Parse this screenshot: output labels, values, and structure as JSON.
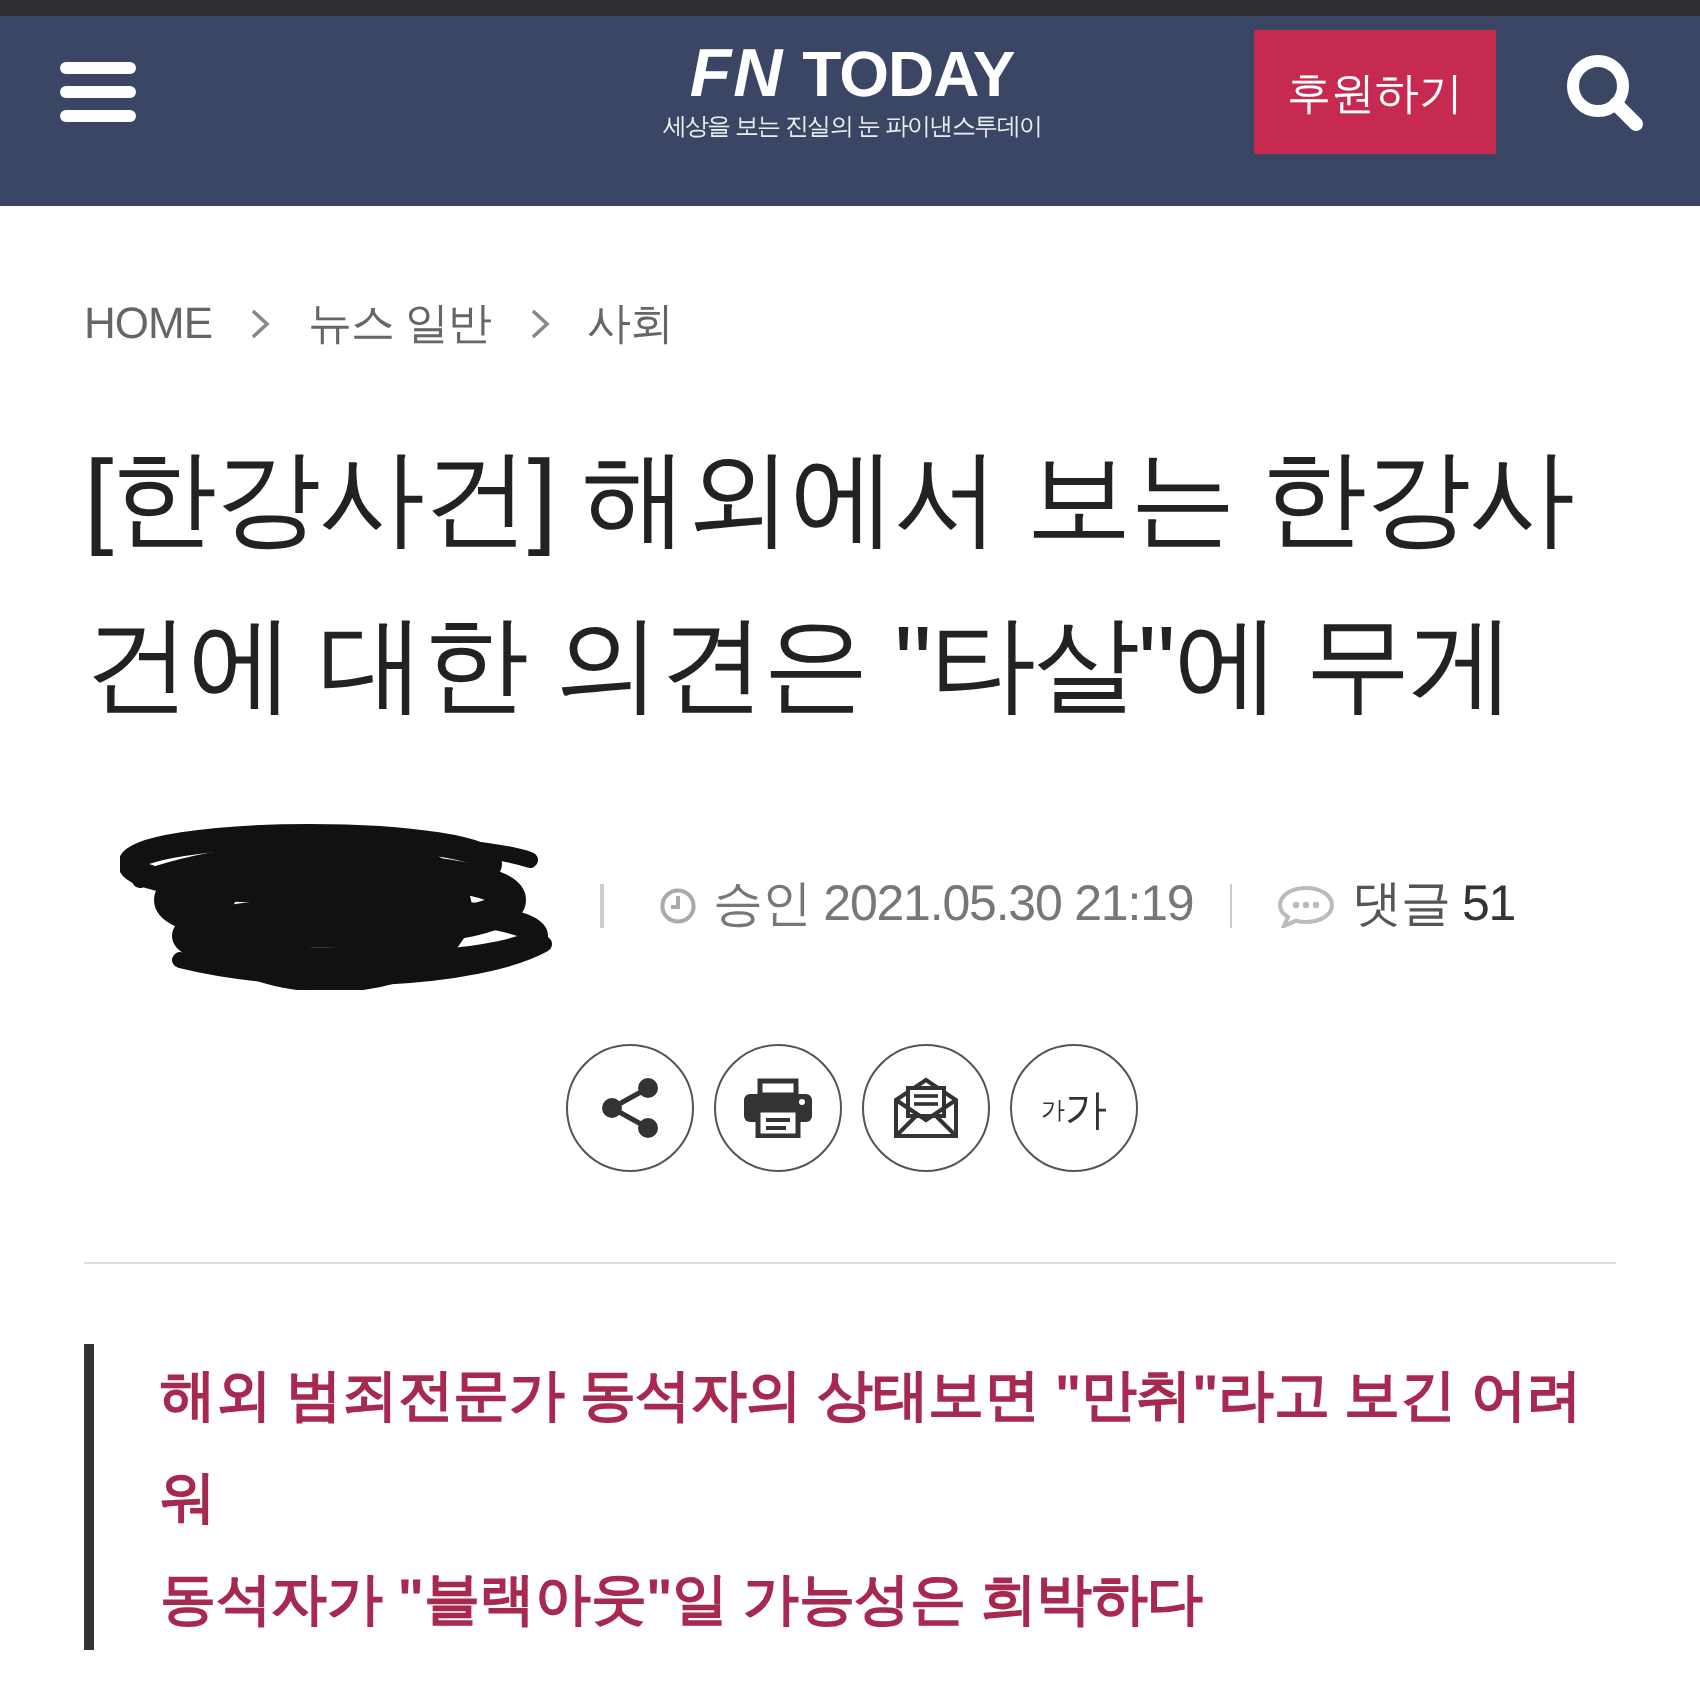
{
  "header": {
    "logo": {
      "mark": "FN",
      "wordmark": "TODAY",
      "tagline": "세상을 보는 진실의 눈 파이낸스투데이"
    },
    "donate_button": "후원하기"
  },
  "breadcrumb": [
    "HOME",
    "뉴스 일반",
    "사회"
  ],
  "title": "[한강사건] 해외에서 보는 한강사건에 대한 의견은 \"타살\"에 무게",
  "meta": {
    "approved": {
      "label": "승인",
      "datetime": "2021.05.30 21:19"
    },
    "comments": {
      "label": "댓글",
      "count": "51"
    }
  },
  "actions": [
    {
      "kind": "share"
    },
    {
      "kind": "print"
    },
    {
      "kind": "email"
    },
    {
      "kind": "font_size",
      "small_label": "가",
      "large_label": "가"
    }
  ],
  "subheadings": [
    "해외 범죄전문가 동석자의 상태보면 \"만취\"라고 보긴 어려워",
    "동석자가 \"블랙아웃\"일 가능성은 희박하다"
  ]
}
